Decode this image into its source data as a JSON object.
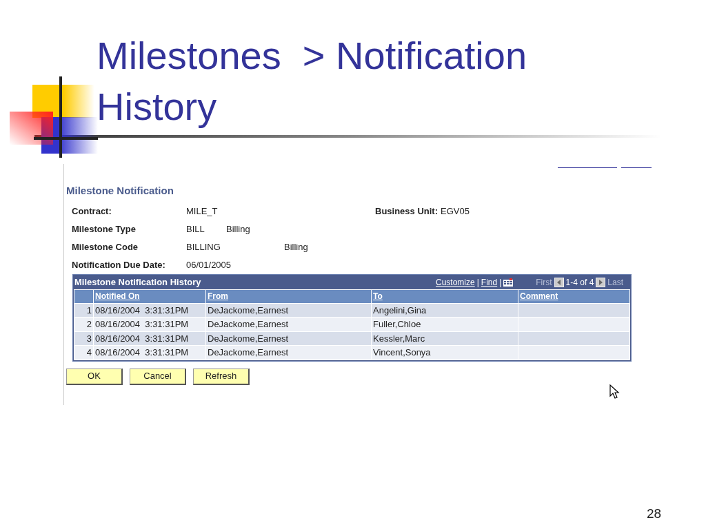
{
  "slide": {
    "title": "Milestones  > Notification History",
    "page_number": "28"
  },
  "page": {
    "heading": "Milestone Notification",
    "fields": [
      {
        "label": "Contract:",
        "values": [
          "MILE_T"
        ]
      },
      {
        "label": "Milestone Type",
        "values": [
          "BILL",
          "Billing"
        ]
      },
      {
        "label": "Milestone Code",
        "values": [
          "BILLING",
          "Billing"
        ]
      },
      {
        "label": "Notification Due Date:",
        "values": [
          "06/01/2005"
        ]
      }
    ],
    "business_unit": {
      "label": "Business Unit:",
      "value": "EGV05"
    },
    "grid": {
      "title": "Milestone Notification History",
      "customize": "Customize",
      "separator_1": "|",
      "find": "Find",
      "separator_2": "|",
      "first": "First",
      "range": "1-4 of 4",
      "last": "Last",
      "columns": [
        "Notified On",
        "From",
        "To",
        "Comment"
      ],
      "rows": [
        {
          "number": "1",
          "cells": [
            "08/16/2004  3:31:31PM",
            "DeJackome,Earnest",
            "Angelini,Gina"
          ]
        },
        {
          "number": "2",
          "cells": [
            "08/16/2004  3:31:31PM",
            "DeJackome,Earnest",
            "Fuller,Chloe"
          ]
        },
        {
          "number": "3",
          "cells": [
            "08/16/2004  3:31:31PM",
            "DeJackome,Earnest",
            "Kessler,Marc"
          ]
        },
        {
          "number": "4",
          "cells": [
            "08/16/2004  3:31:31PM",
            "DeJackome,Earnest",
            "Vincent,Sonya"
          ]
        }
      ]
    },
    "buttons": [
      "OK",
      "Cancel",
      "Refresh"
    ]
  }
}
